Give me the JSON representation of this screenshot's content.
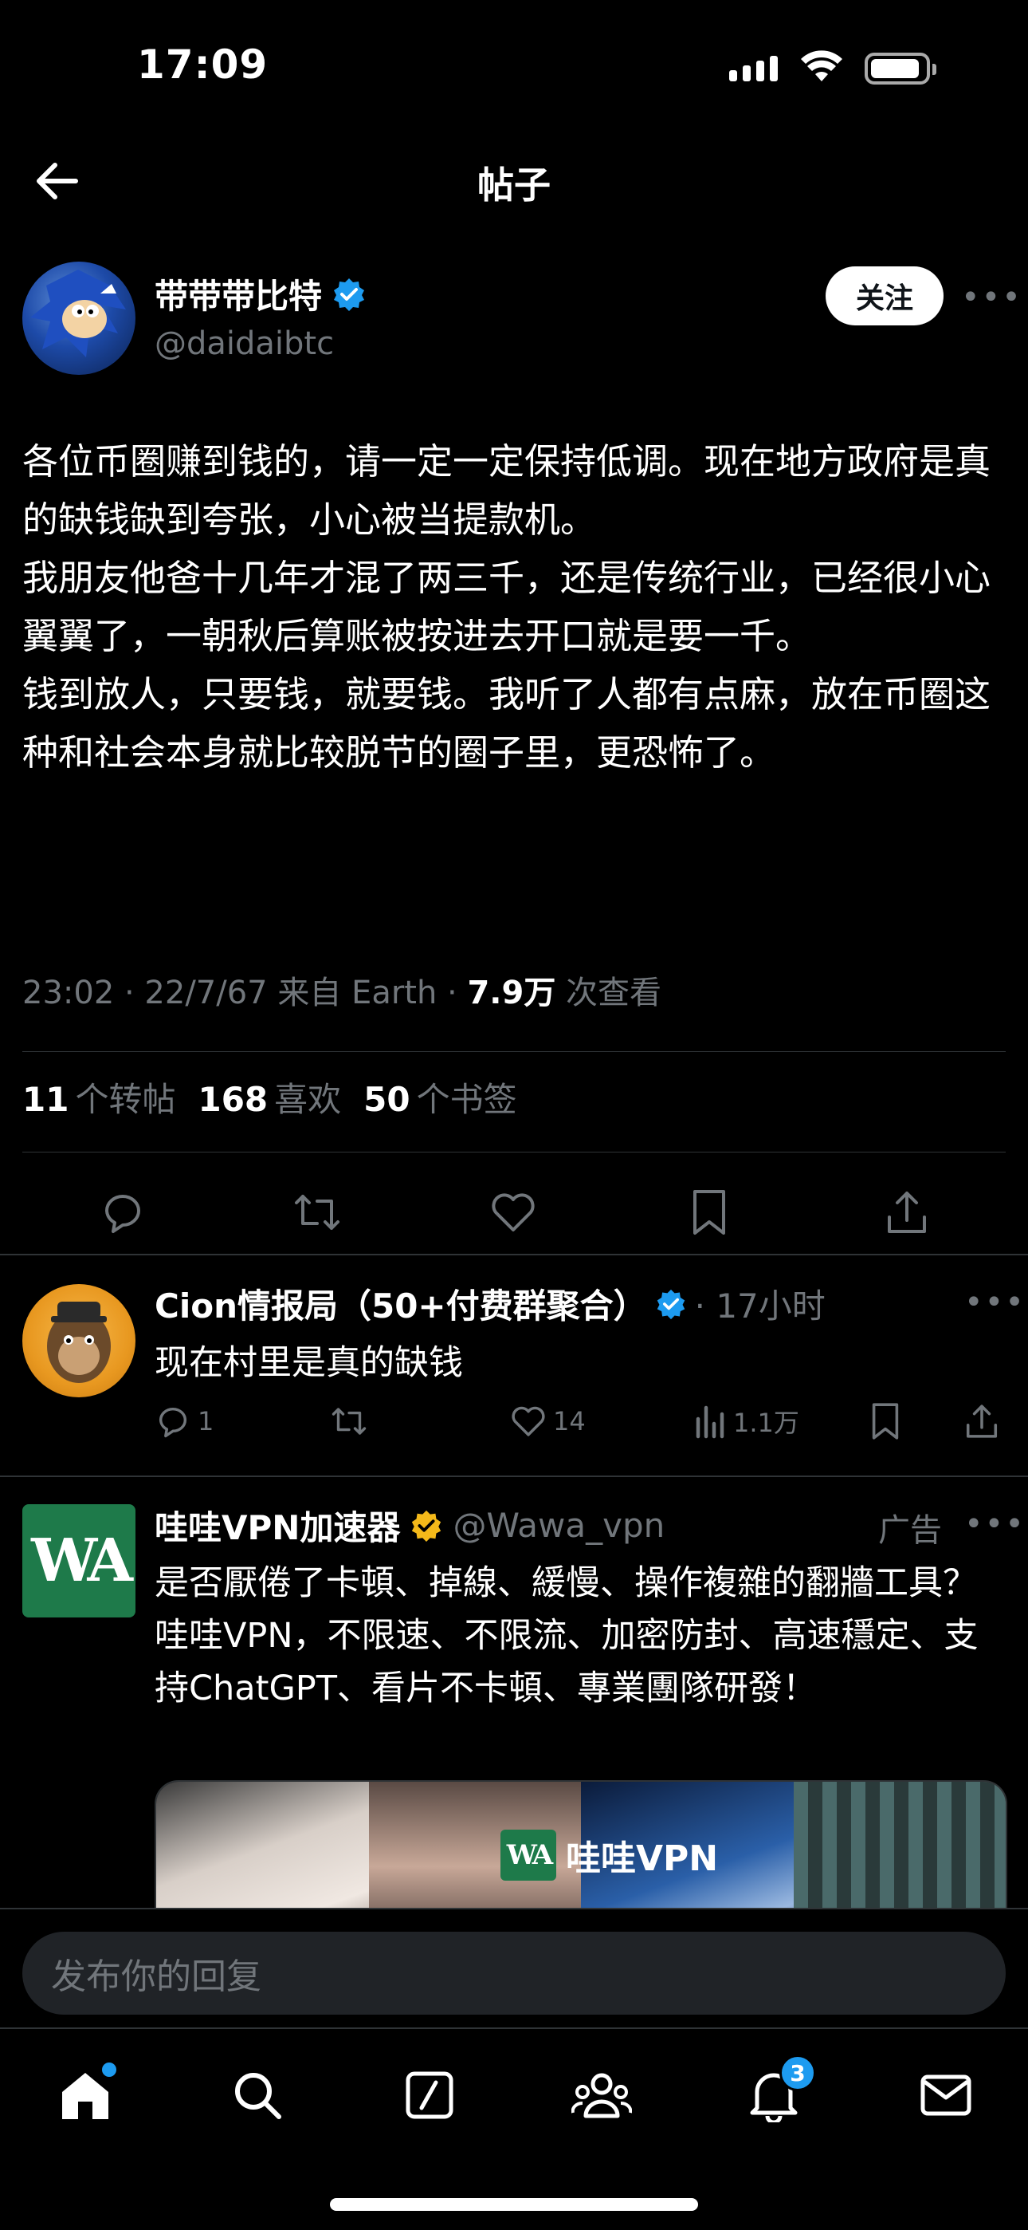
{
  "status_bar": {
    "time": "17:09"
  },
  "nav": {
    "title": "帖子"
  },
  "post": {
    "author_name": "带带带比特",
    "author_handle": "@daidaibtc",
    "follow_label": "关注",
    "body_lines": [
      "各位币圈赚到钱的，请一定一定保持低调。现在地方政府是真的缺钱缺到夸张，小心被当提款机。",
      "我朋友他爸十几年才混了两三千，还是传统行业，已经很小心翼翼了，一朝秋后算账被按进去开口就是要一千。",
      "钱到放人，只要钱，就要钱。我听了人都有点麻，放在币圈这种和社会本身就比较脱节的圈子里，更恐怖了。"
    ],
    "meta_time": "23:02 · 22/7/67 来自 Earth · ",
    "meta_views": "7.9万",
    "meta_views_suffix": " 次查看",
    "reposts_count": "11",
    "reposts_label": "个转帖",
    "likes_count": "168",
    "likes_label": "喜欢",
    "bookmarks_count": "50",
    "bookmarks_label": "个书签"
  },
  "reply": {
    "author_name": "Cion情报局（50+付费群聚合）",
    "time": "· 17小时",
    "text": "现在村里是真的缺钱",
    "replies": "1",
    "reposts": "",
    "likes": "14",
    "views": "1.1万"
  },
  "ad": {
    "avatar_text": "WA",
    "author_name": "哇哇VPN加速器",
    "author_handle": "@Wawa_vpn",
    "label": "广告",
    "body_lines": [
      "是否厭倦了卡頓、掉線、緩慢、操作複雜的翻牆工具？",
      "哇哇VPN，不限速、不限流、加密防封、高速穩定、支持ChatGPT、看片不卡頓、專業團隊研發！"
    ],
    "media_brand": "哇哇VPN",
    "media_mini_logo": "WA"
  },
  "composer": {
    "placeholder": "发布你的回复"
  },
  "tabbar": {
    "notifications_badge": "3"
  },
  "colors": {
    "accent": "#1d9bf0",
    "muted": "#71767b",
    "gold_verified": "#f4b91a",
    "ad_green": "#1e7a4a"
  }
}
